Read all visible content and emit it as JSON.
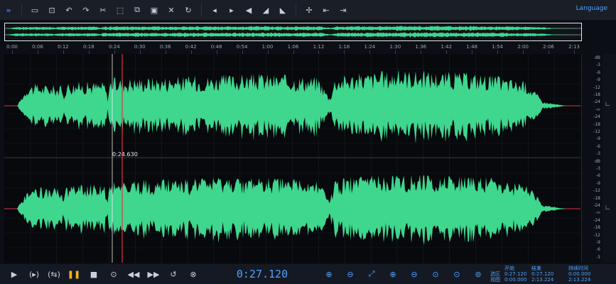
{
  "toolbar": {
    "buttons": [
      {
        "icon": "expand-panel-icon",
        "glyph": "»"
      },
      {
        "icon": "open-folder-icon",
        "glyph": "▭"
      },
      {
        "icon": "export-icon",
        "glyph": "⊡"
      },
      {
        "icon": "undo-icon",
        "glyph": "↶"
      },
      {
        "icon": "redo-icon",
        "glyph": "↷"
      },
      {
        "icon": "cut-icon",
        "glyph": "✂"
      },
      {
        "icon": "crop-icon",
        "glyph": "⬚"
      },
      {
        "icon": "copy-icon",
        "glyph": "⧉"
      },
      {
        "icon": "paste-icon",
        "glyph": "▣"
      },
      {
        "icon": "delete-icon",
        "glyph": "✕"
      },
      {
        "icon": "refresh-icon",
        "glyph": "↻"
      },
      {
        "icon": "fade-in-icon",
        "glyph": "◂"
      },
      {
        "icon": "fade-out-icon",
        "glyph": "▸"
      },
      {
        "icon": "volume-icon",
        "glyph": "◀"
      },
      {
        "icon": "ramp-up-icon",
        "glyph": "◢"
      },
      {
        "icon": "ramp-down-icon",
        "glyph": "◣"
      },
      {
        "icon": "move-icon",
        "glyph": "✢"
      },
      {
        "icon": "shrink-icon",
        "glyph": "⇤"
      },
      {
        "icon": "stretch-icon",
        "glyph": "⇥"
      }
    ],
    "language_label": "Language"
  },
  "timeline": {
    "labels": [
      "0:00",
      "0:06",
      "0:12",
      "0:18",
      "0:24",
      "0:30",
      "0:36",
      "0:42",
      "0:48",
      "0:54",
      "1:00",
      "1:06",
      "1:12",
      "1:18",
      "1:24",
      "1:30",
      "1:36",
      "1:42",
      "1:48",
      "1:54",
      "2:00",
      "2:06",
      "2:13"
    ]
  },
  "db_scale": {
    "labels": [
      "dB",
      "-3",
      "-6",
      "-9",
      "-12",
      "-18",
      "-24",
      "-∞",
      "-24",
      "-18",
      "-12",
      "-9",
      "-6",
      "-3",
      "dB",
      "-3",
      "-6",
      "-9",
      "-12",
      "-18",
      "-24",
      "-∞",
      "-24",
      "-18",
      "-12",
      "-9",
      "-6",
      "-3"
    ]
  },
  "cursor": {
    "time": "0:24.630"
  },
  "transport": {
    "current_time": "0:27.120",
    "buttons": [
      {
        "icon": "play-icon",
        "glyph": "▶"
      },
      {
        "icon": "loop-play-icon",
        "glyph": "(▸)"
      },
      {
        "icon": "loop-icon",
        "glyph": "(⇆)"
      },
      {
        "icon": "pause-icon",
        "glyph": "❚❚"
      },
      {
        "icon": "stop-icon",
        "glyph": "■"
      },
      {
        "icon": "record-icon",
        "glyph": "⊙"
      },
      {
        "icon": "rewind-icon",
        "glyph": "◀◀"
      },
      {
        "icon": "fast-forward-icon",
        "glyph": "▶▶"
      },
      {
        "icon": "repeat-icon",
        "glyph": "↺"
      },
      {
        "icon": "loop-region-icon",
        "glyph": "⊗"
      }
    ],
    "zoom_buttons": [
      {
        "icon": "zoom-in-icon",
        "glyph": "⊕"
      },
      {
        "icon": "zoom-out-icon",
        "glyph": "⊖"
      },
      {
        "icon": "zoom-fit-icon",
        "glyph": "⤢"
      },
      {
        "icon": "zoom-in-selection-icon",
        "glyph": "⊕"
      },
      {
        "icon": "zoom-out-selection-icon",
        "glyph": "⊖"
      },
      {
        "icon": "zoom-left-icon",
        "glyph": "⊙"
      },
      {
        "icon": "zoom-right-icon",
        "glyph": "⊙"
      },
      {
        "icon": "zoom-all-icon",
        "glyph": "⊚"
      }
    ]
  },
  "selection": {
    "headers": [
      "",
      "开始",
      "结束",
      "持续时间"
    ],
    "rows": [
      [
        "选区",
        "0:27.120",
        "0:27.120",
        "0:00.000"
      ],
      [
        "视图",
        "0:00.000",
        "2:13.224",
        "2:13.224"
      ]
    ]
  },
  "colors": {
    "waveform": "#3fd68e",
    "playhead": "#e0334a",
    "accent": "#4ea3ff"
  }
}
